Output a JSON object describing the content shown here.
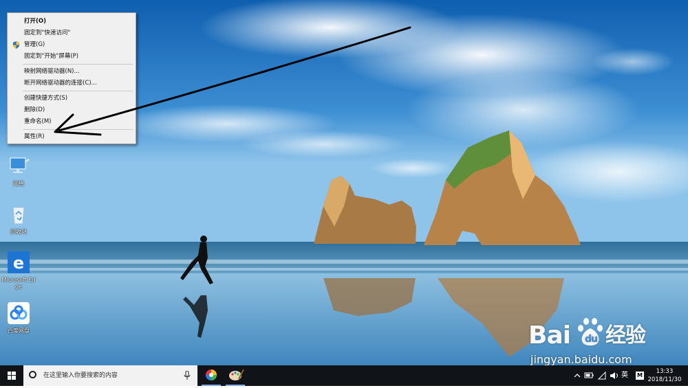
{
  "context_menu": {
    "items": [
      {
        "label": "打开(O)",
        "bold": true
      },
      {
        "label": "固定到\"快速访问\""
      },
      {
        "label": "管理(G)",
        "icon": "shield-icon"
      },
      {
        "label": "固定到\"开始\"屏幕(P)"
      },
      {
        "separator": true
      },
      {
        "label": "映射网络驱动器(N)..."
      },
      {
        "label": "断开网络驱动器的连接(C)..."
      },
      {
        "separator": true
      },
      {
        "label": "创建快捷方式(S)"
      },
      {
        "label": "删除(D)"
      },
      {
        "label": "重命名(M)"
      },
      {
        "separator": true
      },
      {
        "label": "属性(R)"
      }
    ]
  },
  "desktop": {
    "icons": [
      {
        "label": "网络",
        "icon": "network-icon"
      },
      {
        "label": "回收站",
        "icon": "recycle-bin-icon"
      },
      {
        "label": "Microsoft Edge",
        "icon": "edge-icon"
      },
      {
        "label": "百度网盘",
        "icon": "baidu-netdisk-icon"
      }
    ]
  },
  "watermark": {
    "url": "jingyan.baidu.com"
  },
  "taskbar": {
    "search_placeholder": "在这里输入你要搜索的内容",
    "lang": "英",
    "ime": "M",
    "time": "13:33",
    "date": "2018/11/30"
  },
  "colors": {
    "taskbar_bg": "#101318",
    "menu_bg": "#f0f0f0",
    "accent": "#7aa7e0"
  }
}
